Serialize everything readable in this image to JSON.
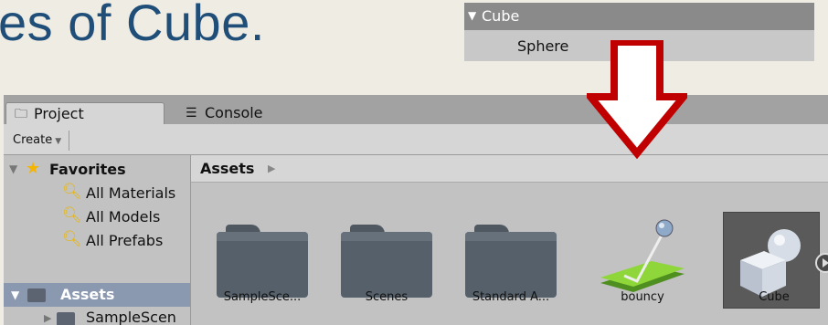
{
  "slide": {
    "title_fragment": "es of Cube."
  },
  "hierarchy": {
    "parent": "Cube",
    "child": "Sphere"
  },
  "window": {
    "tabs": [
      {
        "label": "Project",
        "icon": "folder-icon",
        "active": true
      },
      {
        "label": "Console",
        "icon": "console-icon",
        "active": false
      }
    ],
    "toolbar": {
      "create_label": "Create"
    }
  },
  "sidebar": {
    "favorites_label": "Favorites",
    "favorites": [
      "All Materials",
      "All Models",
      "All Prefabs"
    ],
    "assets_label": "Assets",
    "assets_children": [
      "SampleScen"
    ]
  },
  "main": {
    "breadcrumb": "Assets",
    "assets": [
      {
        "label": "SampleSce...",
        "kind": "folder"
      },
      {
        "label": "Scenes",
        "kind": "folder"
      },
      {
        "label": "Standard A...",
        "kind": "folder"
      },
      {
        "label": "bouncy",
        "kind": "physic-material"
      },
      {
        "label": "Cube",
        "kind": "prefab"
      }
    ]
  },
  "colors": {
    "title": "#1f4e79",
    "arrow": "#c00000",
    "selection": "#8a98b0",
    "star": "#f4b400"
  }
}
